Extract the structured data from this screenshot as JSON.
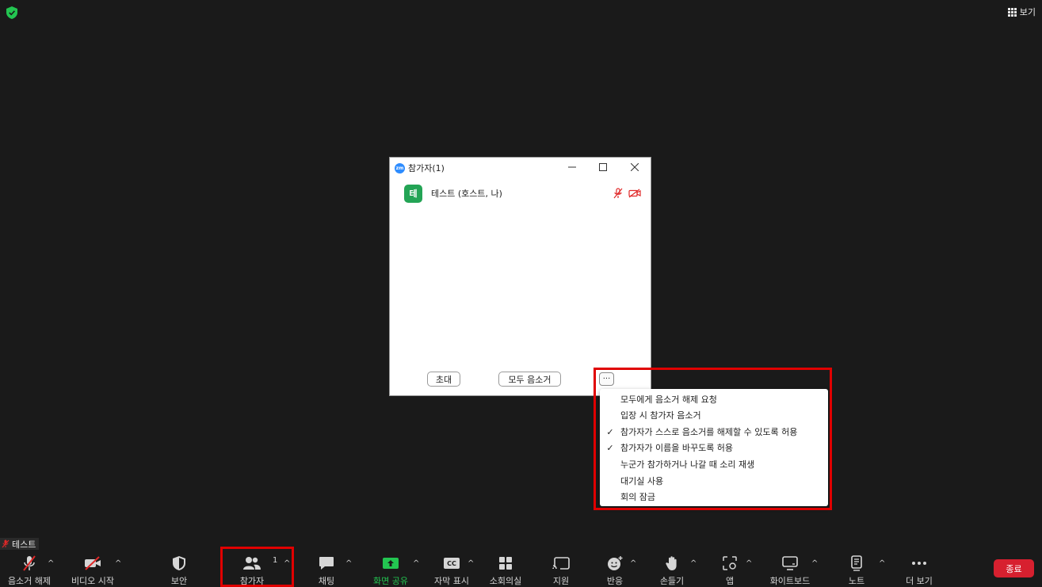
{
  "top": {
    "view_label": "보기"
  },
  "participants_window": {
    "title": "참가자(1)",
    "logo_text": "zm",
    "participant": {
      "initial": "테",
      "name": "테스트 (호스트, 나)"
    },
    "invite_label": "초대",
    "mute_all_label": "모두 음소거",
    "more_label": "···"
  },
  "menu": {
    "items": [
      {
        "label": "모두에게 음소거 해제 요청",
        "checked": ""
      },
      {
        "label": "입장 시 참가자 음소거",
        "checked": ""
      },
      {
        "label": "참가자가 스스로 음소거를 해제할 수 있도록 허용",
        "checked": "✓"
      },
      {
        "label": "참가자가 이름을 바꾸도록 허용",
        "checked": "✓"
      },
      {
        "label": "누군가 참가하거나 나갈 때 소리 재생",
        "checked": ""
      },
      {
        "label": "대기실 사용",
        "checked": ""
      },
      {
        "label": "회의 잠금",
        "checked": ""
      }
    ]
  },
  "nametag": "테스트",
  "toolbar": {
    "unmute": "음소거 해제",
    "start_video": "비디오 시작",
    "security": "보안",
    "participants": "참가자",
    "participants_count": "1",
    "chat": "채팅",
    "share_screen": "화면 공유",
    "captions": "자막 표시",
    "cc_icon_text": "CC",
    "breakout": "소회의실",
    "support": "지원",
    "reactions": "반응",
    "raise_hand": "손들기",
    "apps": "앱",
    "whiteboard": "화이트보드",
    "notes": "노트",
    "more": "더 보기",
    "end": "종료",
    "caret": "^"
  },
  "colors": {
    "background": "#1a1a1a",
    "end_button": "#d7202f",
    "share_green": "#23c551",
    "highlight_red": "#e00000",
    "avatar_green": "#23a455",
    "zoom_blue": "#2d8cff"
  }
}
